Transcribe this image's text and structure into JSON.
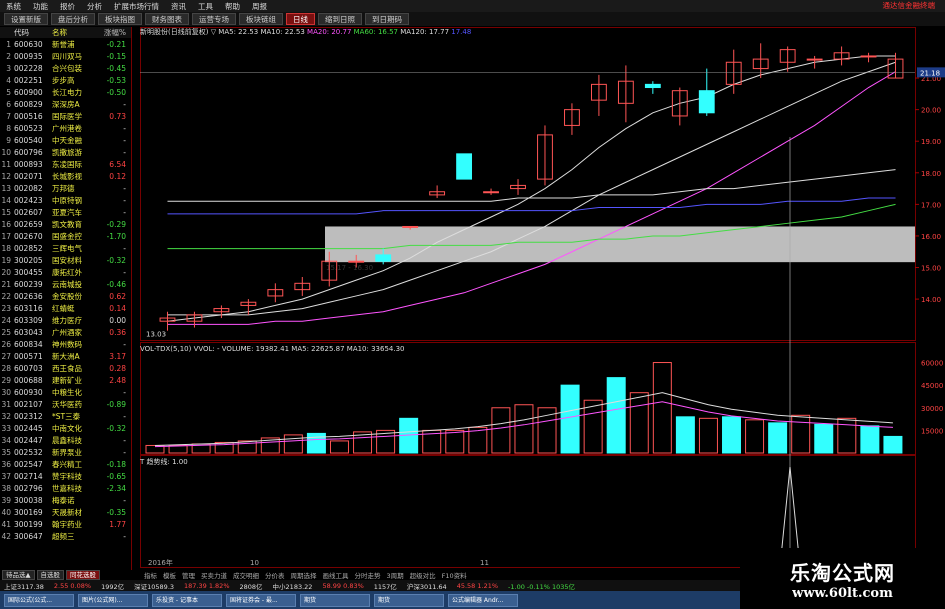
{
  "app": {
    "brand": "通达信金融终端",
    "menu": [
      "系统",
      "功能",
      "报价",
      "分析",
      "扩展市场行情",
      "资讯",
      "工具",
      "帮助",
      "周报"
    ]
  },
  "tabs": [
    {
      "label": "设置新版",
      "active": false
    },
    {
      "label": "盘后分析",
      "active": false
    },
    {
      "label": "板块指图",
      "active": false
    },
    {
      "label": "财务图表",
      "active": false
    },
    {
      "label": "运营专场",
      "active": false
    },
    {
      "label": "板块链组",
      "active": false
    },
    {
      "label": "日线",
      "active": true
    },
    {
      "label": "缩到日照",
      "active": false
    },
    {
      "label": "到日期码",
      "active": false
    }
  ],
  "stock_list": {
    "headers": [
      "",
      "代码",
      "名称",
      "涨幅%"
    ],
    "rows": [
      {
        "n": "1",
        "code": "600630",
        "name": "新誉浦",
        "chg": "-0.21",
        "dir": "down"
      },
      {
        "n": "2",
        "code": "000935",
        "name": "四川双马",
        "chg": "-0.15",
        "dir": "down"
      },
      {
        "n": "3",
        "code": "002228",
        "name": "合兴包装",
        "chg": "-0.45",
        "dir": "down"
      },
      {
        "n": "4",
        "code": "002251",
        "name": "步步高",
        "chg": "-0.53",
        "dir": "down"
      },
      {
        "n": "5",
        "code": "600900",
        "name": "长江电力",
        "chg": "-0.50",
        "dir": "down"
      },
      {
        "n": "6",
        "code": "600829",
        "name": "深深房A",
        "chg": "-",
        "dir": "flat"
      },
      {
        "n": "7",
        "code": "000516",
        "name": "国际医学",
        "chg": "0.73",
        "dir": "up"
      },
      {
        "n": "8",
        "code": "600523",
        "name": "广州港卷",
        "chg": "-",
        "dir": "flat"
      },
      {
        "n": "9",
        "code": "600540",
        "name": "中天金融",
        "chg": "-",
        "dir": "flat"
      },
      {
        "n": "10",
        "code": "600796",
        "name": "凯撒旅游",
        "chg": "-",
        "dir": "flat"
      },
      {
        "n": "11",
        "code": "000893",
        "name": "东凌国际",
        "chg": "6.54",
        "dir": "up"
      },
      {
        "n": "12",
        "code": "002071",
        "name": "长城影视",
        "chg": "0.12",
        "dir": "up"
      },
      {
        "n": "13",
        "code": "002082",
        "name": "万邦德",
        "chg": "-",
        "dir": "flat"
      },
      {
        "n": "14",
        "code": "002423",
        "name": "中原特钢",
        "chg": "-",
        "dir": "flat"
      },
      {
        "n": "15",
        "code": "002607",
        "name": "亚夏汽车",
        "chg": "-",
        "dir": "flat"
      },
      {
        "n": "16",
        "code": "002659",
        "name": "凯文教育",
        "chg": "-0.29",
        "dir": "down"
      },
      {
        "n": "17",
        "code": "002670",
        "name": "国盛金控",
        "chg": "-1.70",
        "dir": "down"
      },
      {
        "n": "18",
        "code": "002852",
        "name": "三辉电气",
        "chg": "-",
        "dir": "flat"
      },
      {
        "n": "19",
        "code": "300205",
        "name": "国安材料",
        "chg": "-0.32",
        "dir": "down"
      },
      {
        "n": "20",
        "code": "300455",
        "name": "康拓红外",
        "chg": "-",
        "dir": "flat"
      },
      {
        "n": "21",
        "code": "600239",
        "name": "云南城投",
        "chg": "-0.46",
        "dir": "down"
      },
      {
        "n": "22",
        "code": "002636",
        "name": "金安股份",
        "chg": "0.62",
        "dir": "up"
      },
      {
        "n": "23",
        "code": "603116",
        "name": "红蜻蜓",
        "chg": "0.14",
        "dir": "up"
      },
      {
        "n": "24",
        "code": "603309",
        "name": "维力医疗",
        "chg": "0.00",
        "dir": "flat"
      },
      {
        "n": "25",
        "code": "603043",
        "name": "广州酒家",
        "chg": "0.36",
        "dir": "up"
      },
      {
        "n": "26",
        "code": "600834",
        "name": "神州数码",
        "chg": "-",
        "dir": "flat"
      },
      {
        "n": "27",
        "code": "000571",
        "name": "新大洲A",
        "chg": "3.17",
        "dir": "up"
      },
      {
        "n": "28",
        "code": "600703",
        "name": "西王食品",
        "chg": "0.28",
        "dir": "up"
      },
      {
        "n": "29",
        "code": "000688",
        "name": "建新矿业",
        "chg": "2.48",
        "dir": "up"
      },
      {
        "n": "30",
        "code": "600930",
        "name": "中粮生化",
        "chg": "-",
        "dir": "flat"
      },
      {
        "n": "31",
        "code": "002107",
        "name": "沃华医药",
        "chg": "-0.89",
        "dir": "down"
      },
      {
        "n": "32",
        "code": "002312",
        "name": "*ST三泰",
        "chg": "-",
        "dir": "flat"
      },
      {
        "n": "33",
        "code": "002445",
        "name": "中南文化",
        "chg": "-0.32",
        "dir": "down"
      },
      {
        "n": "34",
        "code": "002447",
        "name": "晨鑫科技",
        "chg": "-",
        "dir": "flat"
      },
      {
        "n": "35",
        "code": "002532",
        "name": "新界泵业",
        "chg": "-",
        "dir": "flat"
      },
      {
        "n": "36",
        "code": "002547",
        "name": "春兴精工",
        "chg": "-0.18",
        "dir": "down"
      },
      {
        "n": "37",
        "code": "002714",
        "name": "赞宇科技",
        "chg": "-0.65",
        "dir": "down"
      },
      {
        "n": "38",
        "code": "002796",
        "name": "世嘉科技",
        "chg": "-2.34",
        "dir": "down"
      },
      {
        "n": "39",
        "code": "300038",
        "name": "梅泰诺",
        "chg": "-",
        "dir": "flat"
      },
      {
        "n": "40",
        "code": "300169",
        "name": "天晟新材",
        "chg": "-0.35",
        "dir": "down"
      },
      {
        "n": "41",
        "code": "300199",
        "name": "翰宇药业",
        "chg": "1.77",
        "dir": "up"
      },
      {
        "n": "42",
        "code": "300647",
        "name": "超频三",
        "chg": "-",
        "dir": "flat"
      }
    ]
  },
  "bottom_tabs": [
    {
      "label": "待品选▲",
      "active": false
    },
    {
      "label": "自选股",
      "active": false
    },
    {
      "label": "同花选股",
      "active": true
    }
  ],
  "chart": {
    "info_title": "新明股份(日线前复权)",
    "ma_labels": [
      {
        "text": "▽ MA5: 22.53",
        "color": "#dddddd"
      },
      {
        "text": "MA10: 22.53",
        "color": "#dddddd"
      },
      {
        "text": "MA20: 20.77",
        "color": "#ff55ff"
      },
      {
        "text": "MA60: 16.57",
        "color": "#44dd44"
      },
      {
        "text": "MA120: 17.77",
        "color": "#dddddd"
      },
      {
        "text": "17.48",
        "color": "#5555ff"
      }
    ],
    "price_axis": [
      "21.00",
      "20.00",
      "19.00",
      "18.00",
      "17.00",
      "16.00",
      "15.00",
      "14.00"
    ],
    "current_price": "21.18",
    "low_label": "13.03",
    "band_label": "15.17 - 16.30",
    "vol_info": "VOL-TDX(5,10)  VVOL: -  VOLUME: 19382.41  MA5: 22625.87  MA10: 33654.30",
    "vol_axis": [
      "60000",
      "45000",
      "30000",
      "15000"
    ],
    "ind_info": "T 趋势线: 1.00",
    "dates": [
      "2016年",
      "10",
      "11"
    ]
  },
  "chart_data": {
    "type": "candlestick",
    "title": "新明股份(日线前复权)",
    "ylim": [
      12.8,
      22.3
    ],
    "candles": [
      {
        "o": 13.4,
        "h": 13.6,
        "l": 13.0,
        "c": 13.3,
        "up": true
      },
      {
        "o": 13.3,
        "h": 13.6,
        "l": 13.1,
        "c": 13.5,
        "up": true
      },
      {
        "o": 13.6,
        "h": 13.8,
        "l": 13.4,
        "c": 13.7,
        "up": true
      },
      {
        "o": 13.8,
        "h": 14.0,
        "l": 13.5,
        "c": 13.9,
        "up": true
      },
      {
        "o": 14.1,
        "h": 14.5,
        "l": 13.9,
        "c": 14.3,
        "up": true
      },
      {
        "o": 14.3,
        "h": 14.7,
        "l": 14.1,
        "c": 14.5,
        "up": true
      },
      {
        "o": 14.6,
        "h": 15.5,
        "l": 14.4,
        "c": 15.2,
        "up": true
      },
      {
        "o": 15.2,
        "h": 15.4,
        "l": 15.0,
        "c": 15.2,
        "up": true
      },
      {
        "o": 15.4,
        "h": 15.6,
        "l": 15.1,
        "c": 15.2,
        "up": false
      },
      {
        "o": 16.3,
        "h": 16.3,
        "l": 16.2,
        "c": 16.3,
        "up": true
      },
      {
        "o": 17.3,
        "h": 17.6,
        "l": 17.2,
        "c": 17.4,
        "up": true
      },
      {
        "o": 18.6,
        "h": 18.6,
        "l": 17.8,
        "c": 17.8,
        "up": false
      },
      {
        "o": 17.4,
        "h": 17.5,
        "l": 17.3,
        "c": 17.4,
        "up": true
      },
      {
        "o": 17.5,
        "h": 17.8,
        "l": 17.3,
        "c": 17.6,
        "up": true
      },
      {
        "o": 17.8,
        "h": 19.5,
        "l": 17.6,
        "c": 19.2,
        "up": true
      },
      {
        "o": 19.5,
        "h": 20.2,
        "l": 19.2,
        "c": 20.0,
        "up": true
      },
      {
        "o": 20.3,
        "h": 21.1,
        "l": 19.8,
        "c": 20.8,
        "up": true
      },
      {
        "o": 20.2,
        "h": 21.4,
        "l": 19.6,
        "c": 20.9,
        "up": true
      },
      {
        "o": 20.8,
        "h": 20.9,
        "l": 20.5,
        "c": 20.7,
        "up": false
      },
      {
        "o": 19.8,
        "h": 20.7,
        "l": 19.5,
        "c": 20.6,
        "up": true
      },
      {
        "o": 20.6,
        "h": 21.3,
        "l": 19.8,
        "c": 19.9,
        "up": false
      },
      {
        "o": 20.8,
        "h": 21.9,
        "l": 20.5,
        "c": 21.5,
        "up": true
      },
      {
        "o": 21.6,
        "h": 22.1,
        "l": 21.0,
        "c": 21.3,
        "up": true
      },
      {
        "o": 21.5,
        "h": 22.0,
        "l": 21.2,
        "c": 21.9,
        "up": true
      },
      {
        "o": 21.6,
        "h": 21.7,
        "l": 21.3,
        "c": 21.6,
        "up": true
      },
      {
        "o": 21.6,
        "h": 22.0,
        "l": 21.4,
        "c": 21.8,
        "up": true
      },
      {
        "o": 21.7,
        "h": 21.8,
        "l": 21.5,
        "c": 21.7,
        "up": true
      },
      {
        "o": 21.6,
        "h": 21.8,
        "l": 21.0,
        "c": 21.0,
        "up": true
      }
    ],
    "ma_lines": [
      {
        "name": "MA5",
        "color": "#dddddd",
        "values": [
          13.3,
          13.4,
          13.5,
          13.6,
          13.8,
          14.0,
          14.3,
          14.6,
          14.9,
          15.3,
          15.8,
          16.2,
          16.6,
          17.0,
          17.5,
          18.1,
          18.8,
          19.4,
          19.9,
          20.2,
          20.4,
          20.8,
          21.1,
          21.3,
          21.5,
          21.6,
          21.7,
          21.7
        ]
      },
      {
        "name": "MA10",
        "color": "#dddddd",
        "values": [
          13.5,
          13.5,
          13.5,
          13.5,
          13.6,
          13.7,
          13.9,
          14.1,
          14.3,
          14.6,
          14.9,
          15.2,
          15.5,
          15.9,
          16.3,
          16.8,
          17.3,
          17.7,
          18.1,
          18.5,
          18.9,
          19.3,
          19.7,
          20.1,
          20.5,
          20.9,
          21.2,
          21.5
        ]
      },
      {
        "name": "MA20",
        "color": "#ff55ff",
        "values": [
          13.2,
          13.2,
          13.2,
          13.2,
          13.3,
          13.3,
          13.4,
          13.5,
          13.6,
          13.8,
          14.0,
          14.2,
          14.5,
          14.8,
          15.1,
          15.5,
          15.9,
          16.3,
          16.7,
          17.1,
          17.5,
          18.0,
          18.5,
          19.0,
          19.5,
          20.1,
          20.7,
          21.2
        ]
      },
      {
        "name": "MA60",
        "color": "#44dd44",
        "values": [
          15.6,
          15.6,
          15.6,
          15.6,
          15.6,
          15.6,
          15.6,
          15.6,
          15.6,
          15.7,
          15.7,
          15.7,
          15.7,
          15.8,
          15.8,
          15.8,
          15.9,
          15.9,
          16.0,
          16.0,
          16.1,
          16.2,
          16.3,
          16.4,
          16.5,
          16.6,
          16.8,
          17.0
        ]
      },
      {
        "name": "MA120",
        "color": "#dddddd",
        "values": [
          17.1,
          17.1,
          17.1,
          17.1,
          17.1,
          17.1,
          17.1,
          17.1,
          17.1,
          17.1,
          17.1,
          17.1,
          17.1,
          17.2,
          17.2,
          17.2,
          17.3,
          17.3,
          17.3,
          17.4,
          17.5,
          17.5,
          17.6,
          17.7,
          17.8,
          17.9,
          18.0,
          18.1
        ]
      },
      {
        "name": "MA250",
        "color": "#5555ff",
        "values": [
          16.7,
          16.7,
          16.7,
          16.7,
          16.7,
          16.7,
          16.7,
          16.7,
          16.8,
          16.8,
          16.8,
          16.8,
          16.8,
          16.8,
          16.8,
          16.8,
          16.9,
          16.9,
          16.9,
          16.9,
          17.0,
          17.0,
          17.0,
          17.1,
          17.1,
          17.1,
          17.2,
          17.2
        ]
      }
    ],
    "volume": {
      "ylim": [
        0,
        65000
      ],
      "values": [
        5000,
        5000,
        6000,
        7000,
        8000,
        10000,
        12000,
        13000,
        8000,
        14000,
        15000,
        23000,
        15000,
        15000,
        17000,
        30000,
        32000,
        30000,
        45000,
        35000,
        50000,
        40000,
        60000,
        24000,
        23000,
        24000,
        22000,
        20000,
        25000,
        19000,
        23000,
        18000,
        11000
      ],
      "cyan": [
        false,
        false,
        false,
        false,
        false,
        false,
        false,
        true,
        false,
        false,
        false,
        true,
        false,
        false,
        false,
        false,
        false,
        false,
        true,
        false,
        true,
        false,
        false,
        true,
        false,
        true,
        false,
        true,
        false,
        true,
        false,
        true,
        true
      ],
      "ma_values": [
        5000,
        5500,
        6000,
        6500,
        7500,
        8500,
        9500,
        10500,
        11000,
        12000,
        13000,
        14000,
        15000,
        16000,
        17500,
        19500,
        22000,
        25000,
        28000,
        31000,
        34000,
        37000,
        40000,
        36000,
        32000,
        29000,
        27000,
        25000,
        24000,
        23000,
        22000,
        21000,
        20000
      ]
    },
    "band": {
      "low": 15.17,
      "high": 16.3
    }
  },
  "bottom_nav": [
    "指标",
    "模板",
    "管理",
    "买卖力道",
    "成交明细",
    "分价表",
    "周期选择",
    "画线工具",
    "分时走势",
    "3周期",
    "超级对比",
    "F10资料"
  ],
  "status": [
    {
      "text": "上证3117.38",
      "dir": "flat"
    },
    {
      "text": "2.55  0.08%",
      "dir": "up"
    },
    {
      "text": "1992亿",
      "dir": "flat"
    },
    {
      "text": "深证10589.3",
      "dir": "flat"
    },
    {
      "text": "187.39  1.82%",
      "dir": "up"
    },
    {
      "text": "2808亿",
      "dir": "flat"
    },
    {
      "text": "中小2183.22",
      "dir": "flat"
    },
    {
      "text": "58.99  0.83%",
      "dir": "up"
    },
    {
      "text": "1157亿",
      "dir": "flat"
    },
    {
      "text": "沪深3011.64",
      "dir": "flat"
    },
    {
      "text": "45.58  1.21%",
      "dir": "up"
    },
    {
      "text": "-1.00  -0.11%  1035亿",
      "dir": "down"
    }
  ],
  "taskbar": [
    "国际公式(公式...",
    "图片(公式网)...",
    "乐投资 - 记事本",
    "国将证券会 - 最...",
    "期货",
    "期货",
    "公式编辑器 Andr..."
  ],
  "watermark": {
    "title": "乐淘公式网",
    "url": "www.60lt.com"
  }
}
